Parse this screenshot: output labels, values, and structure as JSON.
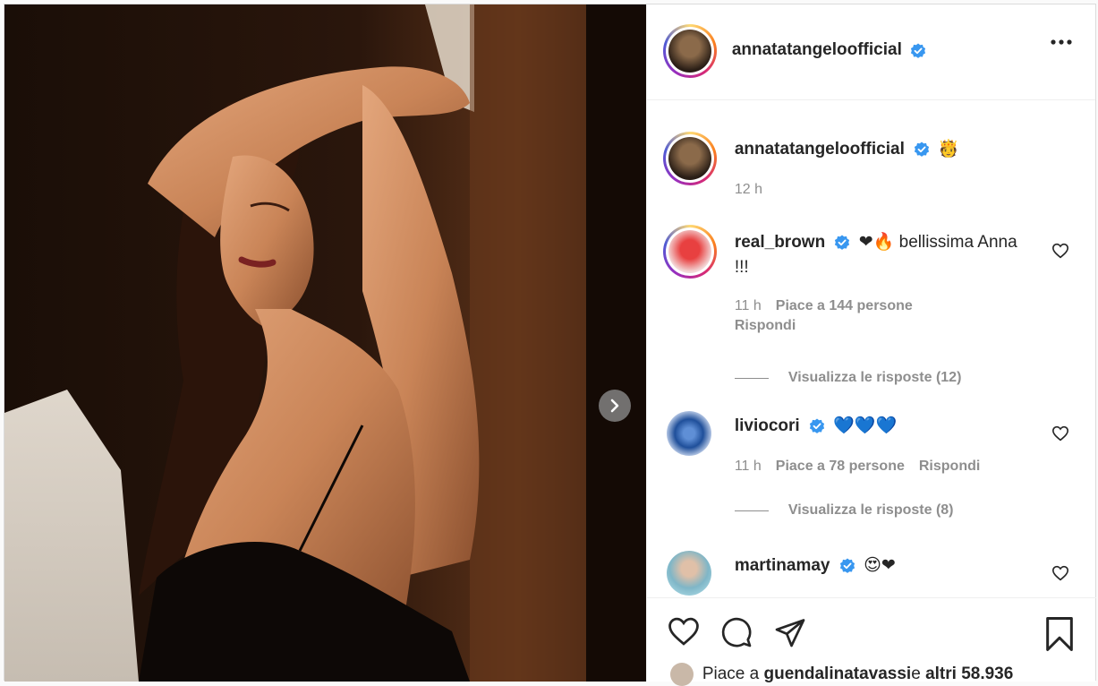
{
  "post": {
    "author": "annatatangeloofficial",
    "caption_emoji": "🫅",
    "caption_time": "12 h"
  },
  "comments": [
    {
      "username": "real_brown",
      "text_emoji": "❤🔥",
      "text": " bellissima Anna !!!",
      "time": "11 h",
      "likes": "Piace a 144 persone",
      "reply": "Rispondi",
      "view_replies": "Visualizza le risposte (12)"
    },
    {
      "username": "liviocori",
      "text_emoji": "💙💙💙",
      "time": "11 h",
      "likes": "Piace a 78 persone",
      "reply": "Rispondi",
      "view_replies": "Visualizza le risposte (8)"
    },
    {
      "username": "martinamay",
      "text_emoji": "😍❤"
    }
  ],
  "likes_summary": {
    "prefix": "Piace a ",
    "user": "guendalinatavassi",
    "middle": " e ",
    "rest": "altri 58.936"
  },
  "icons": {
    "more": "more-options-icon",
    "verified": "verified-badge-icon",
    "like": "heart-icon",
    "comment": "comment-icon",
    "share": "share-icon",
    "save": "bookmark-icon",
    "next": "chevron-right-icon"
  },
  "colors": {
    "verified": "#3897f0",
    "text": "#262626",
    "muted": "#8e8e8e",
    "border": "#dbdbdb"
  }
}
